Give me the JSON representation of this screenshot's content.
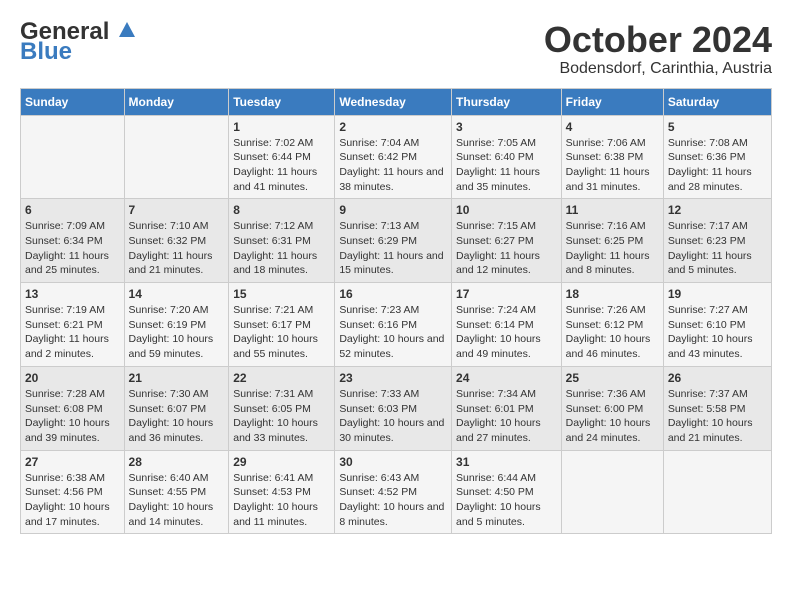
{
  "header": {
    "logo_line1": "General",
    "logo_line2": "Blue",
    "title": "October 2024",
    "subtitle": "Bodensdorf, Carinthia, Austria"
  },
  "days_of_week": [
    "Sunday",
    "Monday",
    "Tuesday",
    "Wednesday",
    "Thursday",
    "Friday",
    "Saturday"
  ],
  "weeks": [
    [
      {
        "day": "",
        "info": ""
      },
      {
        "day": "",
        "info": ""
      },
      {
        "day": "1",
        "info": "Sunrise: 7:02 AM\nSunset: 6:44 PM\nDaylight: 11 hours and 41 minutes."
      },
      {
        "day": "2",
        "info": "Sunrise: 7:04 AM\nSunset: 6:42 PM\nDaylight: 11 hours and 38 minutes."
      },
      {
        "day": "3",
        "info": "Sunrise: 7:05 AM\nSunset: 6:40 PM\nDaylight: 11 hours and 35 minutes."
      },
      {
        "day": "4",
        "info": "Sunrise: 7:06 AM\nSunset: 6:38 PM\nDaylight: 11 hours and 31 minutes."
      },
      {
        "day": "5",
        "info": "Sunrise: 7:08 AM\nSunset: 6:36 PM\nDaylight: 11 hours and 28 minutes."
      }
    ],
    [
      {
        "day": "6",
        "info": "Sunrise: 7:09 AM\nSunset: 6:34 PM\nDaylight: 11 hours and 25 minutes."
      },
      {
        "day": "7",
        "info": "Sunrise: 7:10 AM\nSunset: 6:32 PM\nDaylight: 11 hours and 21 minutes."
      },
      {
        "day": "8",
        "info": "Sunrise: 7:12 AM\nSunset: 6:31 PM\nDaylight: 11 hours and 18 minutes."
      },
      {
        "day": "9",
        "info": "Sunrise: 7:13 AM\nSunset: 6:29 PM\nDaylight: 11 hours and 15 minutes."
      },
      {
        "day": "10",
        "info": "Sunrise: 7:15 AM\nSunset: 6:27 PM\nDaylight: 11 hours and 12 minutes."
      },
      {
        "day": "11",
        "info": "Sunrise: 7:16 AM\nSunset: 6:25 PM\nDaylight: 11 hours and 8 minutes."
      },
      {
        "day": "12",
        "info": "Sunrise: 7:17 AM\nSunset: 6:23 PM\nDaylight: 11 hours and 5 minutes."
      }
    ],
    [
      {
        "day": "13",
        "info": "Sunrise: 7:19 AM\nSunset: 6:21 PM\nDaylight: 11 hours and 2 minutes."
      },
      {
        "day": "14",
        "info": "Sunrise: 7:20 AM\nSunset: 6:19 PM\nDaylight: 10 hours and 59 minutes."
      },
      {
        "day": "15",
        "info": "Sunrise: 7:21 AM\nSunset: 6:17 PM\nDaylight: 10 hours and 55 minutes."
      },
      {
        "day": "16",
        "info": "Sunrise: 7:23 AM\nSunset: 6:16 PM\nDaylight: 10 hours and 52 minutes."
      },
      {
        "day": "17",
        "info": "Sunrise: 7:24 AM\nSunset: 6:14 PM\nDaylight: 10 hours and 49 minutes."
      },
      {
        "day": "18",
        "info": "Sunrise: 7:26 AM\nSunset: 6:12 PM\nDaylight: 10 hours and 46 minutes."
      },
      {
        "day": "19",
        "info": "Sunrise: 7:27 AM\nSunset: 6:10 PM\nDaylight: 10 hours and 43 minutes."
      }
    ],
    [
      {
        "day": "20",
        "info": "Sunrise: 7:28 AM\nSunset: 6:08 PM\nDaylight: 10 hours and 39 minutes."
      },
      {
        "day": "21",
        "info": "Sunrise: 7:30 AM\nSunset: 6:07 PM\nDaylight: 10 hours and 36 minutes."
      },
      {
        "day": "22",
        "info": "Sunrise: 7:31 AM\nSunset: 6:05 PM\nDaylight: 10 hours and 33 minutes."
      },
      {
        "day": "23",
        "info": "Sunrise: 7:33 AM\nSunset: 6:03 PM\nDaylight: 10 hours and 30 minutes."
      },
      {
        "day": "24",
        "info": "Sunrise: 7:34 AM\nSunset: 6:01 PM\nDaylight: 10 hours and 27 minutes."
      },
      {
        "day": "25",
        "info": "Sunrise: 7:36 AM\nSunset: 6:00 PM\nDaylight: 10 hours and 24 minutes."
      },
      {
        "day": "26",
        "info": "Sunrise: 7:37 AM\nSunset: 5:58 PM\nDaylight: 10 hours and 21 minutes."
      }
    ],
    [
      {
        "day": "27",
        "info": "Sunrise: 6:38 AM\nSunset: 4:56 PM\nDaylight: 10 hours and 17 minutes."
      },
      {
        "day": "28",
        "info": "Sunrise: 6:40 AM\nSunset: 4:55 PM\nDaylight: 10 hours and 14 minutes."
      },
      {
        "day": "29",
        "info": "Sunrise: 6:41 AM\nSunset: 4:53 PM\nDaylight: 10 hours and 11 minutes."
      },
      {
        "day": "30",
        "info": "Sunrise: 6:43 AM\nSunset: 4:52 PM\nDaylight: 10 hours and 8 minutes."
      },
      {
        "day": "31",
        "info": "Sunrise: 6:44 AM\nSunset: 4:50 PM\nDaylight: 10 hours and 5 minutes."
      },
      {
        "day": "",
        "info": ""
      },
      {
        "day": "",
        "info": ""
      }
    ]
  ]
}
